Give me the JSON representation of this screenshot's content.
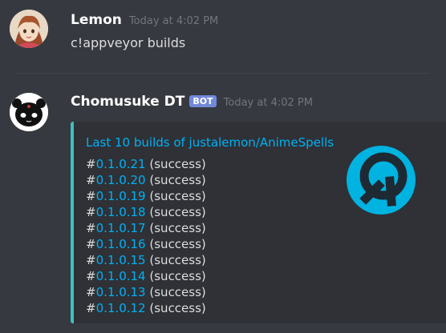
{
  "messages": [
    {
      "username": "Lemon",
      "timestamp": "Today at 4:02 PM",
      "content": "c!appveyor builds"
    },
    {
      "username": "Chomusuke DT",
      "bot_tag": "BOT",
      "timestamp": "Today at 4:02 PM",
      "embed": {
        "accent_color": "#3ebfc7",
        "title": "Last 10 builds of justalemon/AnimeSpells",
        "thumbnail_icon": "appveyor-logo-icon",
        "builds": [
          {
            "hash": "#",
            "version": "0.1.0.21",
            "status": "(success)"
          },
          {
            "hash": "#",
            "version": "0.1.0.20",
            "status": "(success)"
          },
          {
            "hash": "#",
            "version": "0.1.0.19",
            "status": "(success)"
          },
          {
            "hash": "#",
            "version": "0.1.0.18",
            "status": "(success)"
          },
          {
            "hash": "#",
            "version": "0.1.0.17",
            "status": "(success)"
          },
          {
            "hash": "#",
            "version": "0.1.0.16",
            "status": "(success)"
          },
          {
            "hash": "#",
            "version": "0.1.0.15",
            "status": "(success)"
          },
          {
            "hash": "#",
            "version": "0.1.0.14",
            "status": "(success)"
          },
          {
            "hash": "#",
            "version": "0.1.0.13",
            "status": "(success)"
          },
          {
            "hash": "#",
            "version": "0.1.0.12",
            "status": "(success)"
          }
        ]
      }
    }
  ],
  "colors": {
    "background": "#36393f",
    "embed_background": "#2f3136",
    "link": "#00b0f4",
    "bot_tag": "#7289da"
  }
}
